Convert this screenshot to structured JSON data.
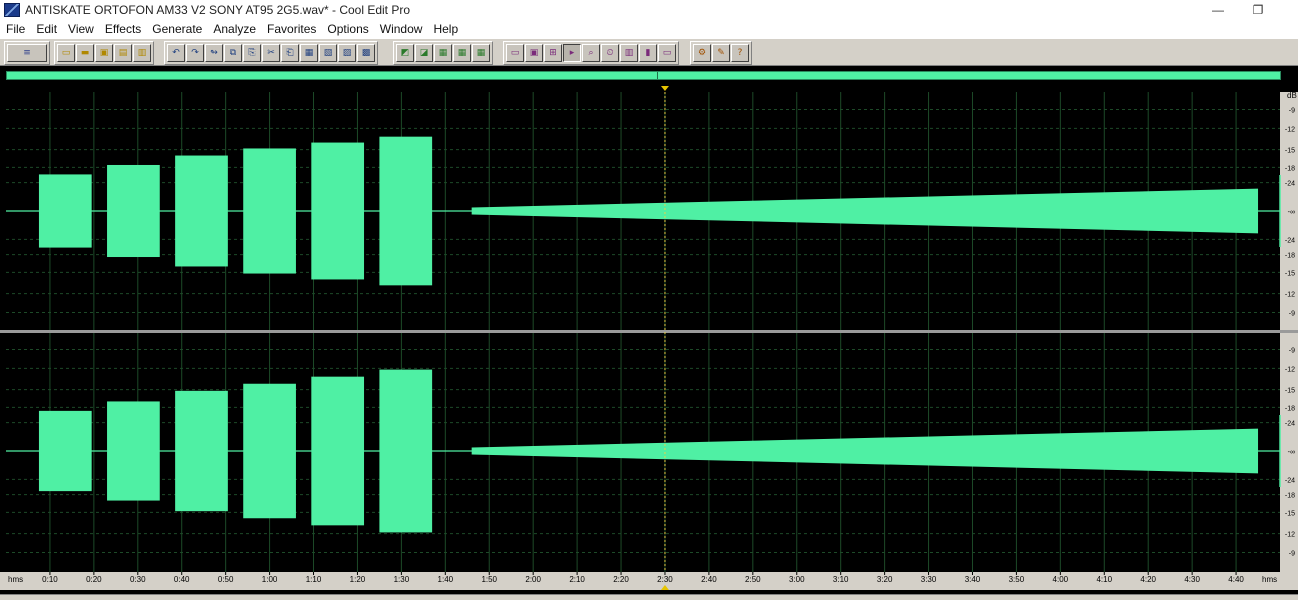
{
  "window": {
    "title": "ANTISKATE ORTOFON AM33 V2 SONY AT95 2G5.wav* - Cool Edit Pro",
    "minimize_glyph": "—",
    "restore_glyph": "❐"
  },
  "menu": [
    "File",
    "Edit",
    "View",
    "Effects",
    "Generate",
    "Analyze",
    "Favorites",
    "Options",
    "Window",
    "Help"
  ],
  "toolbar": {
    "groups": [
      {
        "name": "mode",
        "buttons": [
          {
            "icon": "multitrack-view-icon",
            "glyph": "≡"
          }
        ]
      },
      {
        "name": "file",
        "buttons": [
          {
            "icon": "new-file-icon",
            "glyph": "▭"
          },
          {
            "icon": "open-file-icon",
            "glyph": "▬"
          },
          {
            "icon": "save-file-icon",
            "glyph": "▣"
          },
          {
            "icon": "save-all-icon",
            "glyph": "▤"
          },
          {
            "icon": "close-file-icon",
            "glyph": "▥"
          }
        ]
      },
      {
        "name": "edit",
        "buttons": [
          {
            "icon": "undo-icon",
            "glyph": "↶"
          },
          {
            "icon": "redo-icon",
            "glyph": "↷"
          },
          {
            "icon": "repeat-icon",
            "glyph": "↬"
          },
          {
            "icon": "copy-icon",
            "glyph": "⧉"
          },
          {
            "icon": "copy-new-icon",
            "glyph": "⎘"
          },
          {
            "icon": "cut-icon",
            "glyph": "✂"
          },
          {
            "icon": "paste-icon",
            "glyph": "⎗"
          },
          {
            "icon": "paste-new-icon",
            "glyph": "▦"
          },
          {
            "icon": "mix-paste-icon",
            "glyph": "▧"
          },
          {
            "icon": "trim-icon",
            "glyph": "▨"
          },
          {
            "icon": "crop-icon",
            "glyph": "▩"
          }
        ]
      },
      {
        "name": "display",
        "buttons": [
          {
            "icon": "waveform-view-icon",
            "glyph": "◩"
          },
          {
            "icon": "spectral-view-icon",
            "glyph": "◪"
          },
          {
            "icon": "show-grid-icon",
            "glyph": "▦"
          },
          {
            "icon": "show-markers-icon",
            "glyph": "▦"
          },
          {
            "icon": "show-cue-icon",
            "glyph": "▦"
          }
        ]
      },
      {
        "name": "zoom",
        "buttons": [
          {
            "icon": "zoom-full-icon",
            "glyph": "▭"
          },
          {
            "icon": "zoom-selection-icon",
            "glyph": "▣"
          },
          {
            "icon": "zoom-in-icon",
            "glyph": "⊞"
          },
          {
            "icon": "play-zoom-icon",
            "glyph": "▸"
          },
          {
            "icon": "find-zoom-icon",
            "glyph": "⌕"
          },
          {
            "icon": "time-zoom-icon",
            "glyph": "⏲"
          },
          {
            "icon": "vertical-zoom-icon",
            "glyph": "▥"
          },
          {
            "icon": "level-meters-icon",
            "glyph": "▮"
          },
          {
            "icon": "fit-window-icon",
            "glyph": "▭"
          }
        ]
      },
      {
        "name": "help",
        "buttons": [
          {
            "icon": "settings-icon",
            "glyph": "⚙"
          },
          {
            "icon": "script-icon",
            "glyph": "✎"
          },
          {
            "icon": "help-icon",
            "glyph": "?"
          }
        ]
      }
    ]
  },
  "editor": {
    "time_unit_label": "hms",
    "duration_seconds": 290,
    "cursor_time_seconds": 150,
    "wave_color": "#4ff0a4",
    "grid_color": "#1d4a28",
    "background_color": "#000000",
    "time_ticks": [
      "0:10",
      "0:20",
      "0:30",
      "0:40",
      "0:50",
      "1:00",
      "1:10",
      "1:20",
      "1:30",
      "1:40",
      "1:50",
      "2:00",
      "2:10",
      "2:20",
      "2:30",
      "2:40",
      "2:50",
      "3:00",
      "3:10",
      "3:20",
      "3:30",
      "3:40",
      "3:50",
      "4:00",
      "4:10",
      "4:20",
      "4:30",
      "4:40"
    ],
    "db_unit_label": "dB",
    "channels": [
      {
        "name": "left",
        "db_labels": [
          "-9",
          "-12",
          "-15",
          "-18",
          "-24",
          "-∞",
          "-24",
          "-18",
          "-15",
          "-12",
          "-9"
        ],
        "tone_bursts": [
          {
            "start": 7.5,
            "end": 19.5,
            "amplitude": 0.31
          },
          {
            "start": 23,
            "end": 35,
            "amplitude": 0.39
          },
          {
            "start": 38.5,
            "end": 50.5,
            "amplitude": 0.47
          },
          {
            "start": 54,
            "end": 66,
            "amplitude": 0.53
          },
          {
            "start": 69.5,
            "end": 81.5,
            "amplitude": 0.58
          },
          {
            "start": 85,
            "end": 97,
            "amplitude": 0.63
          }
        ],
        "sweep": {
          "start": 106,
          "end": 285,
          "amplitude_start": 0.03,
          "amplitude_end": 0.19
        }
      },
      {
        "name": "right",
        "db_labels": [
          "-9",
          "-12",
          "-15",
          "-18",
          "-24",
          "-∞",
          "-24",
          "-18",
          "-15",
          "-12",
          "-9"
        ],
        "tone_bursts": [
          {
            "start": 7.5,
            "end": 19.5,
            "amplitude": 0.34
          },
          {
            "start": 23,
            "end": 35,
            "amplitude": 0.42
          },
          {
            "start": 38.5,
            "end": 50.5,
            "amplitude": 0.51
          },
          {
            "start": 54,
            "end": 66,
            "amplitude": 0.57
          },
          {
            "start": 69.5,
            "end": 81.5,
            "amplitude": 0.63
          },
          {
            "start": 85,
            "end": 97,
            "amplitude": 0.69
          }
        ],
        "sweep": {
          "start": 106,
          "end": 285,
          "amplitude_start": 0.03,
          "amplitude_end": 0.19
        }
      }
    ]
  }
}
